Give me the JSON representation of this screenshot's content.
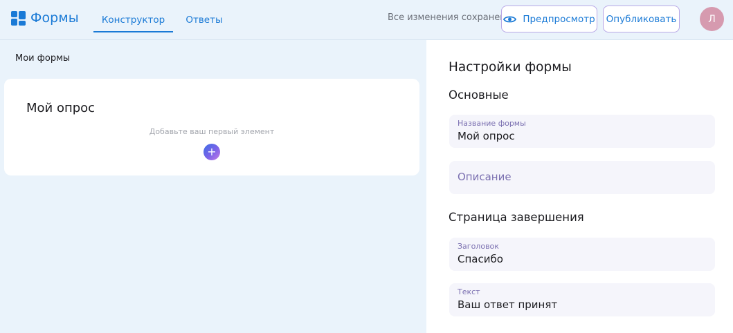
{
  "header": {
    "logo_text": "Формы",
    "tabs": [
      {
        "label": "Конструктор",
        "active": true
      },
      {
        "label": "Ответы",
        "active": false
      }
    ],
    "save_status": "Все изменения сохранены",
    "preview_label": "Предпросмотр",
    "publish_label": "Опубликовать",
    "avatar_initial": "Л"
  },
  "left": {
    "title": "Мои формы",
    "form": {
      "name": "Мой опрос",
      "hint": "Добавьте ваш первый элемент",
      "add_symbol": "+"
    }
  },
  "settings": {
    "title": "Настройки формы",
    "basic_section": "Основные",
    "form_name_label": "Название формы",
    "form_name_value": "Мой опрос",
    "description_placeholder": "Описание",
    "completion_section": "Страница завершения",
    "heading_label": "Заголовок",
    "heading_value": "Спасибо",
    "text_label": "Текст",
    "text_value": "Ваш ответ принят"
  },
  "colors": {
    "accent": "#1a7ad6",
    "background": "#eaf3fb",
    "button_border": "#b7a6e6",
    "avatar": "#d69aaf",
    "field_bg": "#f5f5fb"
  }
}
